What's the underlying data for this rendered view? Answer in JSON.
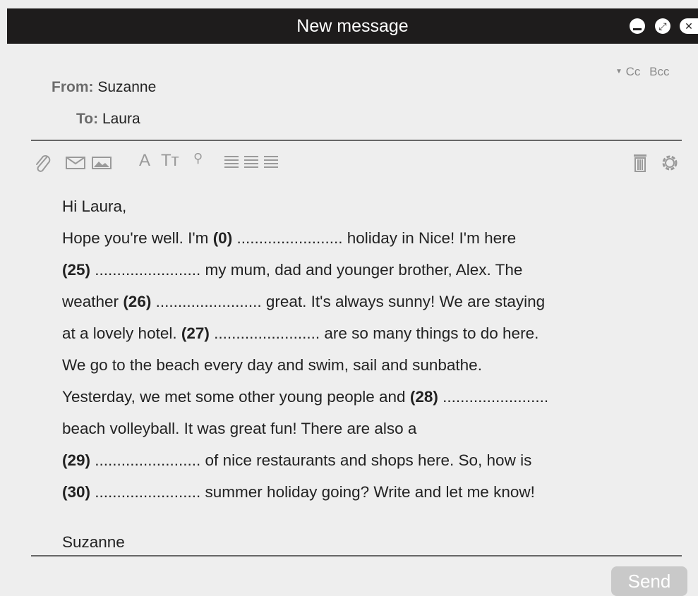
{
  "window": {
    "title": "New message",
    "controls": [
      "minimize-icon",
      "expand-icon",
      "close-icon"
    ]
  },
  "header": {
    "from_label": "From:",
    "from_value": "Suzanne",
    "to_label": "To:",
    "to_value": "Laura",
    "cc_label": "Cc",
    "bcc_label": "Bcc"
  },
  "toolbar": {
    "icons": [
      "paperclip-icon",
      "envelope-icon",
      "image-icon",
      "font-size-icon",
      "text-size-icon",
      "link-icon",
      "align-icon",
      "trash-icon",
      "gear-icon"
    ],
    "font_size_glyph": "A",
    "text_size_glyph": "Tт"
  },
  "message": {
    "greeting": "Hi Laura,",
    "lines": [
      {
        "gap": "(0)",
        "pre": "Hope you're well. I'm ",
        "post": " ........................ holiday in Nice! I'm here"
      },
      {
        "gap": "(25)",
        "pre": "",
        "post": " ........................ my mum, dad and younger brother, Alex. The"
      },
      {
        "gap": "(26)",
        "pre": "weather ",
        "post": " ........................  great. It's always sunny! We are staying"
      },
      {
        "gap": "(27)",
        "pre": "at a lovely hotel. ",
        "post": " ........................ are so many things to do here."
      },
      {
        "gap": "",
        "pre": "We go to the beach every day and swim, sail and sunbathe.",
        "post": ""
      },
      {
        "gap": "(28)",
        "pre": "Yesterday, we met some other young people and ",
        "post": " ........................"
      },
      {
        "gap": "",
        "pre": "beach volleyball. It was great fun! There are also a",
        "post": ""
      },
      {
        "gap": "(29)",
        "pre": "",
        "post": " ........................ of nice restaurants and shops here. So, how is"
      },
      {
        "gap": "(30)",
        "pre": "",
        "post": " ........................ summer holiday going? Write and let me know!"
      }
    ],
    "signature": "Suzanne"
  },
  "footer": {
    "send_label": "Send"
  },
  "colors": {
    "titlebar": "#1e1c1c",
    "background": "#eeeeee",
    "send_button": "#c9c9c9"
  }
}
